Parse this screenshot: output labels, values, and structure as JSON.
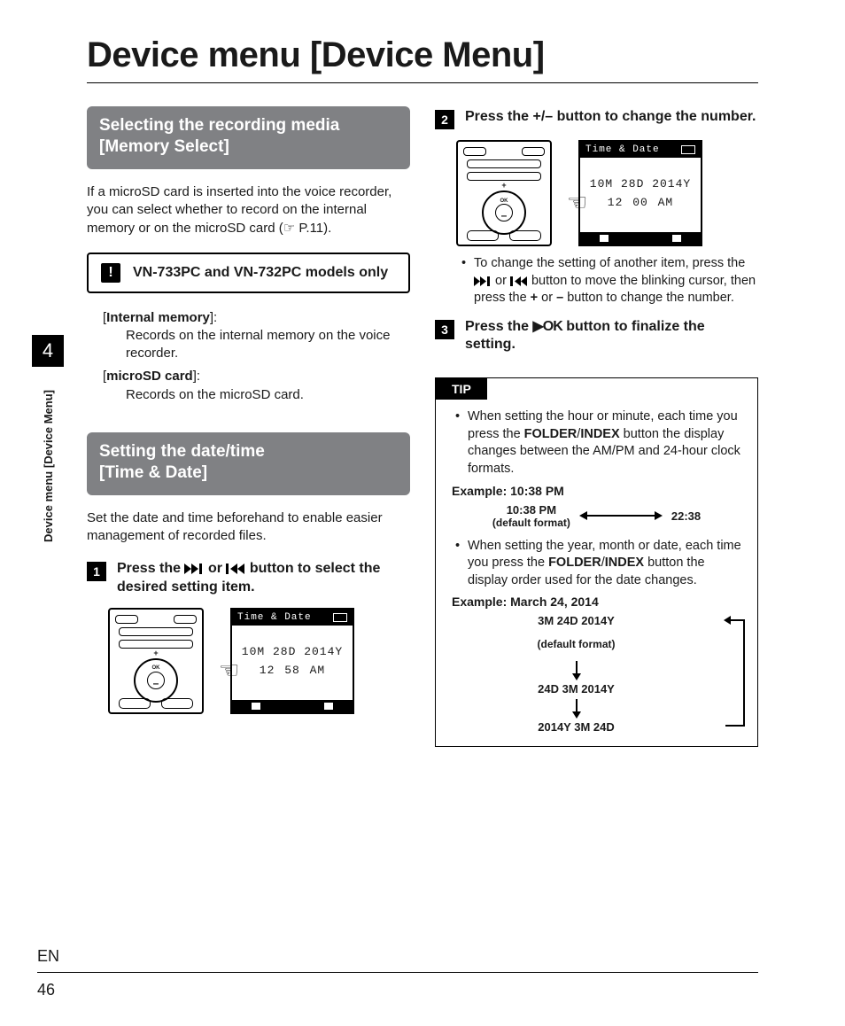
{
  "header": {
    "title": "Device menu [Device Menu]"
  },
  "margin": {
    "chapter": "4",
    "sidelabel": "Device menu [Device Menu]",
    "lang": "EN",
    "pagenum": "46"
  },
  "left": {
    "box1": {
      "line1": "Selecting the recording media",
      "line2": "[Memory Select]"
    },
    "para1": "If a microSD card is inserted into the voice recorder, you can select whether to record on the internal memory or on the microSD card (☞ P.11).",
    "note": "VN-733PC and VN-732PC models only",
    "defs": {
      "t1a": "[",
      "t1b": "Internal memory",
      "t1c": "]:",
      "d1": "Records on the internal memory on the voice recorder.",
      "t2a": "[",
      "t2b": "microSD card",
      "t2c": "]:",
      "d2": "Records on the microSD card."
    },
    "box2": {
      "line1": "Setting the date/time",
      "line2": "[Time & Date]"
    },
    "para2": "Set the date and time beforehand to enable easier management of recorded files.",
    "step1": {
      "num": "1",
      "pre": "Press the ",
      "mid": " or ",
      "post": " button to select the desired setting item."
    },
    "lcd": {
      "bartitle": "Time & Date",
      "dateline": "10M 28D 2014Y",
      "timeline_a": "12 ",
      "timeline_b_sel": "58",
      "timeline_c": " AM",
      "ok": "OK"
    }
  },
  "right": {
    "step2": {
      "num": "2",
      "pre": "Press the ",
      "btn": "+/–",
      "post": " button to change the number."
    },
    "lcd": {
      "bartitle": "Time & Date",
      "dateline": "10M 28D 2014Y",
      "timeline_a": "12 ",
      "timeline_b_sel": "00",
      "timeline_c": " AM",
      "ok": "OK"
    },
    "sub1": {
      "a": "To change the setting of another item, press the ",
      "b": " or ",
      "c": " button to move the blinking cursor, then press the ",
      "plus": "+",
      "d": " or ",
      "minus": "–",
      "e": " button to change the number."
    },
    "step3": {
      "num": "3",
      "pre": "Press the ",
      "btn": "▶OK",
      "post": " button to finalize the setting."
    },
    "tip": {
      "label": "TIP",
      "b1a": "When setting the hour or minute, each time you press the ",
      "b1b": "FOLDER",
      "b1c": "/",
      "b1d": "INDEX",
      "b1e": " button the display changes between the AM/PM and 24-hour clock formats.",
      "ex1": "Example: 10:38 PM",
      "ex1L1": "10:38 PM",
      "ex1L2": "(default format)",
      "ex1R": "22:38",
      "b2a": "When setting the year, month or date, each time you press the ",
      "b2b": "FOLDER",
      "b2c": "/",
      "b2d": "INDEX",
      "b2e": " button the display order used for the date changes.",
      "ex2": "Example: March 24, 2014",
      "f1": "3M 24D 2014Y",
      "f1s": "(default format)",
      "f2": "24D 3M 2014Y",
      "f3": "2014Y 3M 24D"
    }
  }
}
